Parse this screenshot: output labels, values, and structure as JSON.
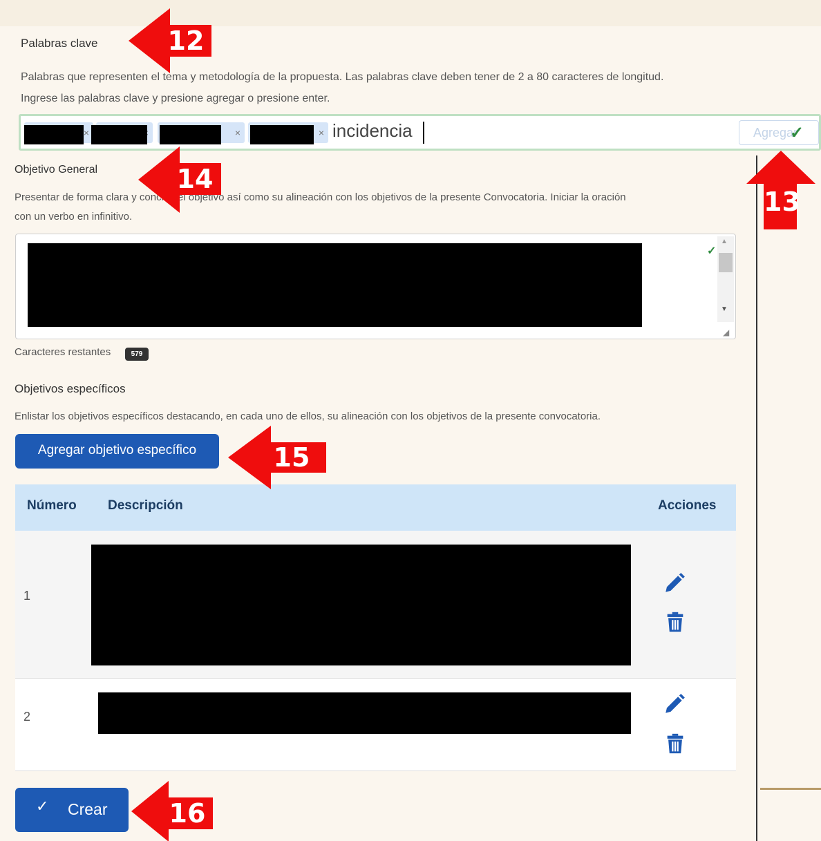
{
  "keywords": {
    "title": "Palabras clave",
    "description_line1": "Palabras que representen el tema y metodología de la propuesta. Las palabras clave deben tener de 2 a 80 caracteres de longitud.",
    "description_line2": "Ingrese las palabras clave y presione agregar o presione enter.",
    "chip_remove": "×",
    "typed_value": "incidencia",
    "add_button": "Agregar"
  },
  "general_objective": {
    "title": "Objetivo General",
    "description_line1": "Presentar de forma clara y concisa el objetivo así como su alineación con los objetivos de la presente Convocatoria. Iniciar la oración",
    "description_line2": "con un verbo en infinitivo.",
    "chars_label": "Caracteres restantes",
    "chars_remaining": "579"
  },
  "specific_objectives": {
    "title": "Objetivos específicos",
    "description": "Enlistar los objetivos específicos destacando, en cada uno de ellos, su alineación con los objetivos de la presente convocatoria.",
    "add_button": "Agregar objetivo específico",
    "table": {
      "headers": [
        "Número",
        "Descripción",
        "Acciones"
      ],
      "rows": [
        {
          "number": "1"
        },
        {
          "number": "2"
        }
      ]
    }
  },
  "create_button": "Crear",
  "annotations": [
    "12",
    "13",
    "14",
    "15",
    "16"
  ],
  "colors": {
    "primary": "#1e5ab4",
    "annotation": "#ef0d0d",
    "table_header": "#cfe5f8",
    "valid": "#2e8b3e"
  }
}
